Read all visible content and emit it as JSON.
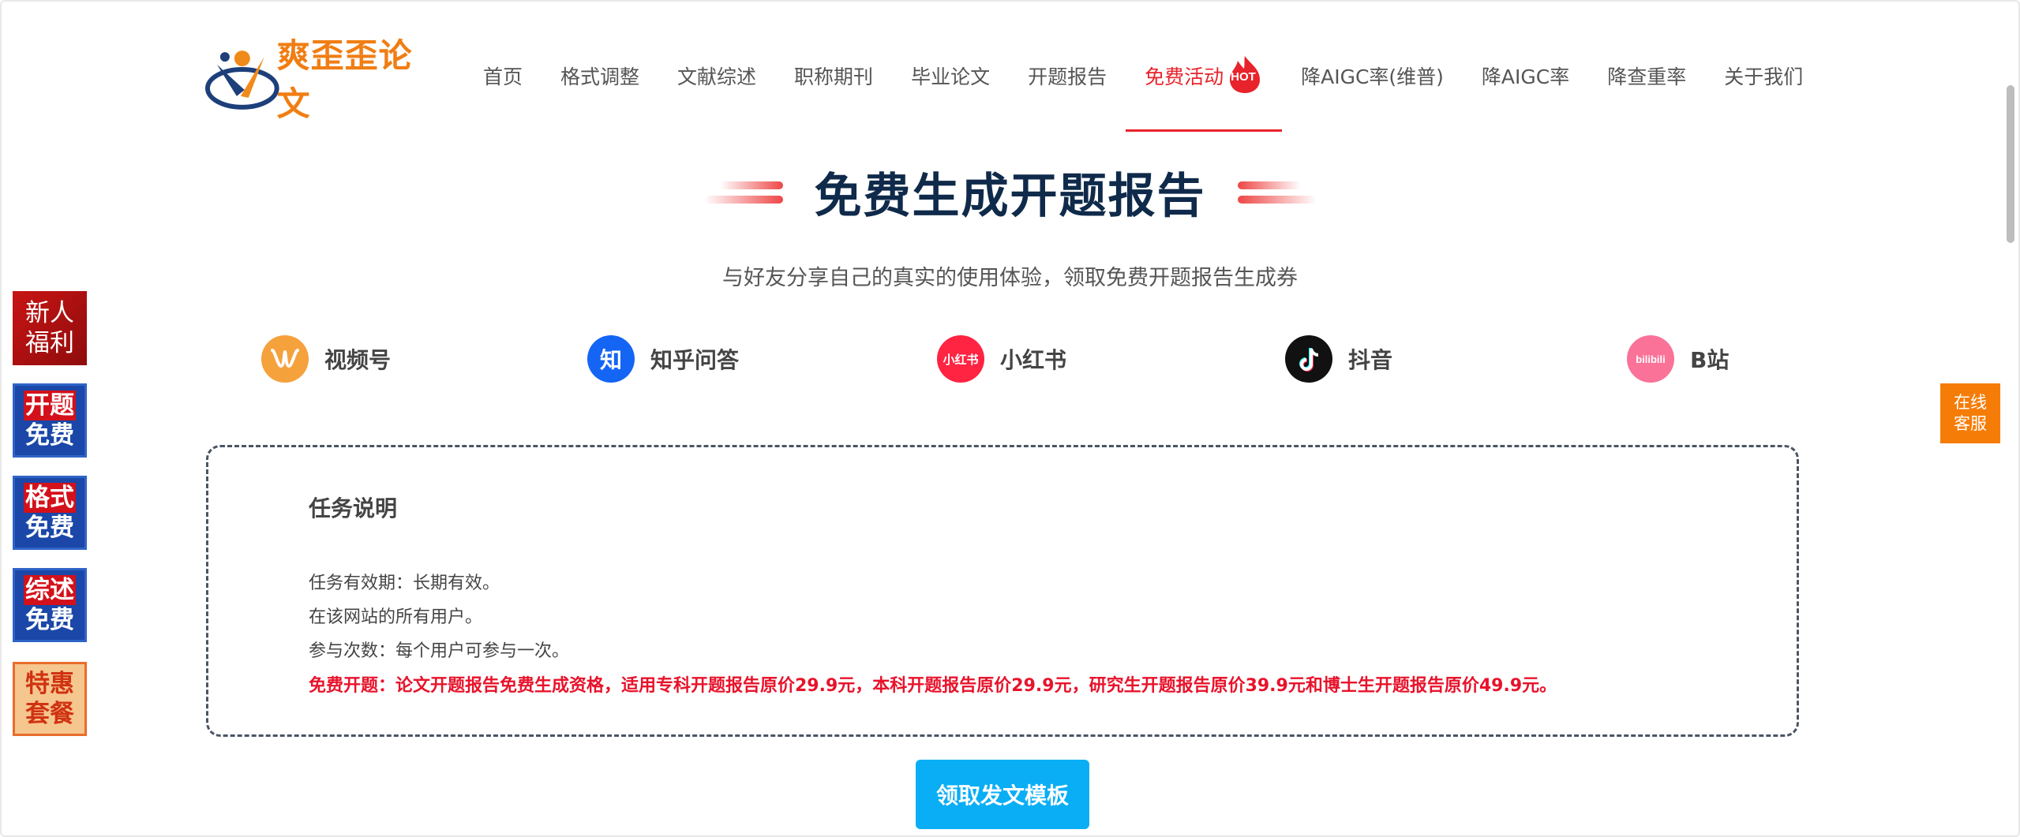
{
  "brand": {
    "name": "爽歪歪论文"
  },
  "nav": {
    "items": [
      "首页",
      "格式调整",
      "文献综述",
      "职称期刊",
      "毕业论文",
      "开题报告",
      "免费活动",
      "降AIGC率(维普)",
      "降AIGC率",
      "降查重率",
      "关于我们"
    ],
    "active": "免费活动",
    "hot_badge": "HOT"
  },
  "page": {
    "title": "免费生成开题报告",
    "subtitle": "与好友分享自己的真实的使用体验，领取免费开题报告生成券"
  },
  "platforms": [
    {
      "label": "视频号",
      "icon": "wechat-channels-icon",
      "color": "#f5a13c"
    },
    {
      "label": "知乎问答",
      "icon": "zhihu-icon",
      "icon_text": "知",
      "color": "#1565f5"
    },
    {
      "label": "小红书",
      "icon": "xiaohongshu-icon",
      "icon_text": "小红书",
      "color": "#ff2442"
    },
    {
      "label": "抖音",
      "icon": "douyin-icon",
      "color": "#111111"
    },
    {
      "label": "B站",
      "icon": "bilibili-icon",
      "icon_text": "bilibili",
      "color": "#fb7299"
    }
  ],
  "task": {
    "title": "任务说明",
    "lines": [
      "任务有效期：长期有效。",
      "在该网站的所有用户。",
      "参与次数：每个用户可参与一次。"
    ],
    "highlight": "免费开题：论文开题报告免费生成资格，适用专科开题报告原价29.9元，本科开题报告原价29.9元，研究生开题报告原价39.9元和博士生开题报告原价49.9元。"
  },
  "cta": {
    "label": "领取发文模板"
  },
  "side_badges": {
    "newbie": [
      "新人",
      "福利"
    ],
    "proposal": [
      "开题",
      "免费"
    ],
    "format": [
      "格式",
      "免费"
    ],
    "review": [
      "综述",
      "免费"
    ],
    "special": [
      "特惠",
      "套餐"
    ]
  },
  "service": {
    "label_line1": "在线",
    "label_line2": "客服"
  }
}
